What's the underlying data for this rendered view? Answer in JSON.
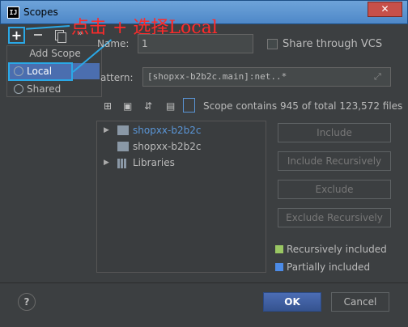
{
  "window": {
    "title": "Scopes",
    "app_icon": "intellij-icon",
    "close": "✕"
  },
  "toolbar": {
    "add": "+",
    "more": "»"
  },
  "popup": {
    "header": "Add Scope",
    "items": [
      {
        "label": "Local",
        "icon": "local-scope-icon",
        "selected": true
      },
      {
        "label": "Shared",
        "icon": "shared-scope-icon",
        "selected": false
      }
    ]
  },
  "annotation": {
    "text": "点击 + 选择Local",
    "color": "#ff2a2a"
  },
  "form": {
    "name_label": "Name:",
    "name_value": "1",
    "share_label": "Share through VCS",
    "pattern_label": "attern:",
    "pattern_value": "[shopxx-b2b2c.main]:net..*"
  },
  "scope_summary": "Scope contains 945 of total 123,572 files",
  "tree": [
    {
      "label": "shopxx-b2b2c",
      "expandable": true,
      "highlighted": true,
      "icon": "module-folder-icon"
    },
    {
      "label": "shopxx-b2b2c",
      "expandable": false,
      "highlighted": false,
      "icon": "module-folder-icon"
    },
    {
      "label": "Libraries",
      "expandable": true,
      "highlighted": false,
      "icon": "libraries-icon"
    }
  ],
  "actions": {
    "include": "Include",
    "include_recursively": "Include Recursively",
    "exclude": "Exclude",
    "exclude_recursively": "Exclude Recursively"
  },
  "legend": [
    {
      "label": "Recursively included",
      "color": "#9ac763"
    },
    {
      "label": "Partially included",
      "color": "#4c8be6"
    }
  ],
  "footer": {
    "help": "?",
    "ok": "OK",
    "cancel": "Cancel"
  },
  "colors": {
    "accent": "#2aa8e6",
    "selection": "#4b6eaf",
    "background": "#3c3f41"
  }
}
